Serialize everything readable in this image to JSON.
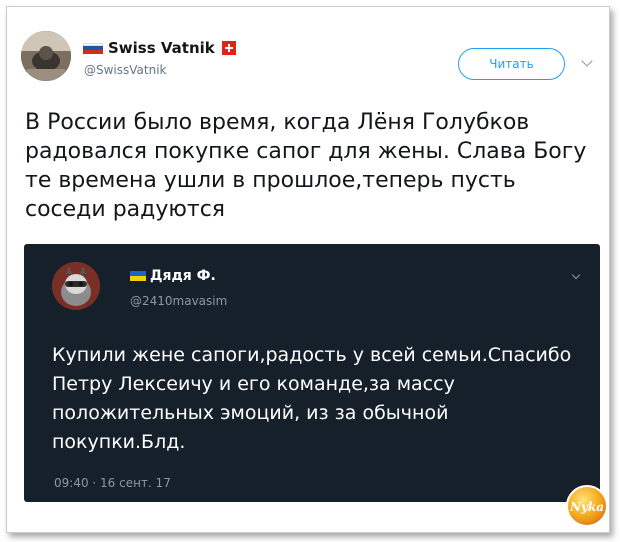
{
  "tweet": {
    "display_name": "Swiss Vatnik",
    "handle": "@SwissVatnik",
    "follow_label": "Читать",
    "text": "В России было время, когда Лёня Голубков радовался покупке сапог для жены. Слава Богу те времена ушли в прошлое,теперь пусть соседи радуются"
  },
  "quoted": {
    "display_name": "Дядя Ф.",
    "handle": "@2410mavasim",
    "text": "Купили жене сапоги,радость у всей семьи.Спасибо Петру Лексеичу и его команде,за массу положительных эмоций, из за обычной покупки.Блд.",
    "timestamp": "09:40 · 16 сент. 17"
  },
  "watermark": {
    "text": "Nyka"
  },
  "icons": [
    "avatar",
    "russia-flag-icon",
    "swiss-flag-icon",
    "chevron-down-icon",
    "ukraine-flag-icon",
    "watermark-logo"
  ],
  "colors": {
    "accent": "#1da1f2",
    "quote_bg": "#15202b",
    "muted": "#657786"
  }
}
